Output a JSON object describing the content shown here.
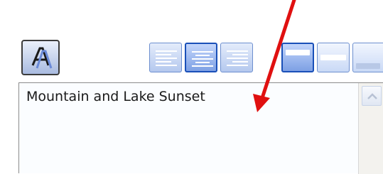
{
  "textbox": {
    "value": "Mountain and Lake Sunset"
  },
  "toolbar": {
    "font_button_icon": "font-style-icon",
    "align_selected": "center",
    "valign_selected": "top"
  },
  "annotation": {
    "arrow_color": "#e01010"
  },
  "colors": {
    "button_border": "#1a50b8",
    "button_fill": "#7da0e4"
  }
}
